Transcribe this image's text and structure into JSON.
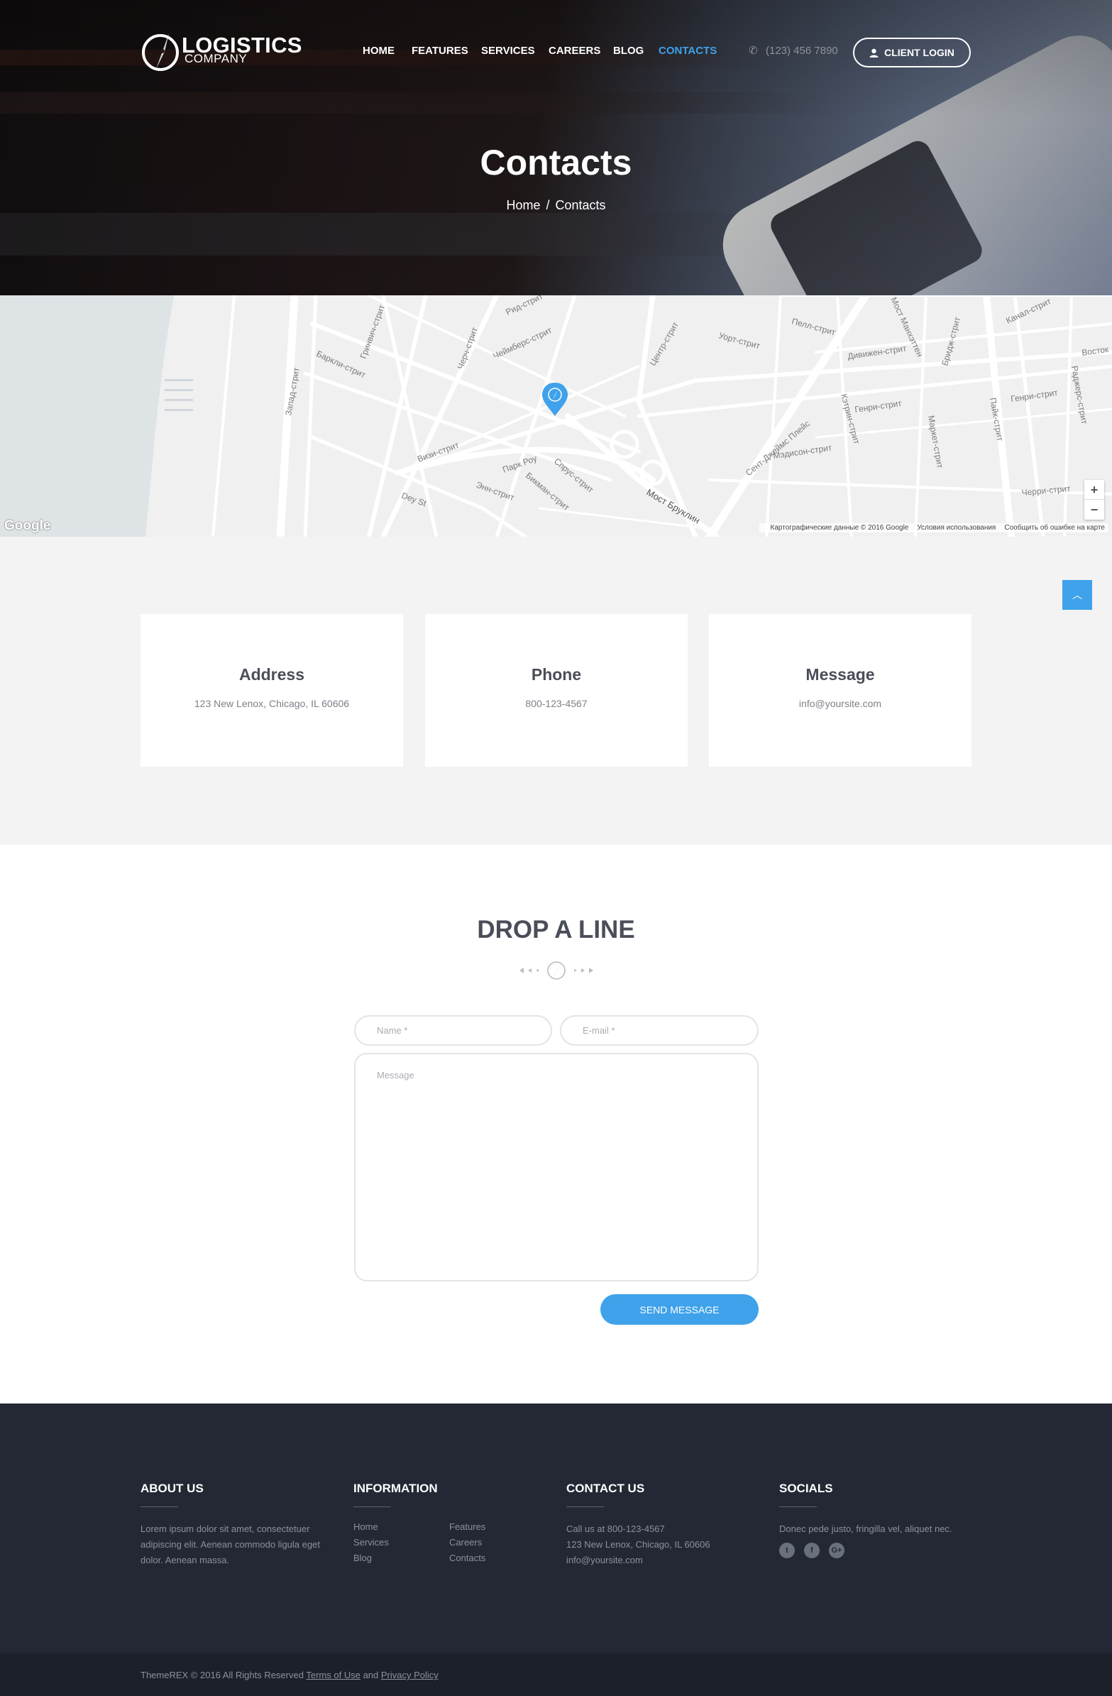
{
  "brand": {
    "name_line1": "LOGISTICS",
    "name_line2": "COMPANY",
    "accent_color": "#3fa2ea"
  },
  "nav": {
    "items": [
      {
        "label": "HOME",
        "active": false
      },
      {
        "label": "FEATURES",
        "active": false
      },
      {
        "label": "SERVICES",
        "active": false
      },
      {
        "label": "CAREERS",
        "active": false
      },
      {
        "label": "BLOG",
        "active": false
      },
      {
        "label": "CONTACTS",
        "active": true
      }
    ],
    "phone": "(123) 456 7890",
    "phone_icon": "phone-icon",
    "client_login": "CLIENT LOGIN",
    "client_icon": "user-icon"
  },
  "hero": {
    "title": "Contacts",
    "breadcrumb": {
      "home": "Home",
      "separator": "/",
      "current": "Contacts"
    }
  },
  "map": {
    "provider": "Google",
    "attribution": "Картографические данные © 2016 Google",
    "terms": "Условия использования",
    "report": "Сообщить об ошибке на карте",
    "zoom_in": "+",
    "zoom_out": "−",
    "street_labels": [
      "Рид-стрит",
      "Чеймберс-стрит",
      "Баркли-стрит",
      "Гринвич-стрит",
      "Черч-стрит",
      "Запад-стрит",
      "Центр-стрит",
      "Пелл-стрит",
      "Уорт-стрит",
      "Дивижен-стрит",
      "Мост Манхэттен",
      "Бридж-стрит",
      "Канал-стрит",
      "Восток",
      "Генри-стрит",
      "Маркет-стрит",
      "Пайк-стрит",
      "Раджерс-стрит",
      "Кэтрин-стрит",
      "Сент-Джеймс Плейс",
      "Мэдисон-стрит",
      "Черри-стрит",
      "Визи-стрит",
      "Парк Роу",
      "Спрус-стрит",
      "Бикман-стрит",
      "Энн-стрит",
      "Dey St",
      "Мост Бруклин"
    ],
    "pin_icon": "map-pin-icon"
  },
  "cards": [
    {
      "title": "Address",
      "text": "123 New Lenox, Chicago, IL 60606"
    },
    {
      "title": "Phone",
      "text": "800-123-4567"
    },
    {
      "title": "Message",
      "text": "info@yoursite.com"
    }
  ],
  "back_to_top_icon": "chevron-up-icon",
  "form": {
    "title": "DROP A LINE",
    "name_placeholder": "Name *",
    "email_placeholder": "E-mail *",
    "message_placeholder": "Message",
    "submit": "SEND MESSAGE"
  },
  "footer": {
    "about": {
      "title": "ABOUT US",
      "text": "Lorem ipsum dolor sit amet, consectetuer adipiscing elit. Aenean commodo ligula eget dolor. Aenean massa."
    },
    "information": {
      "title": "INFORMATION",
      "links": [
        "Home",
        "Features",
        "Services",
        "Careers",
        "Blog",
        "Contacts"
      ]
    },
    "contact": {
      "title": "CONTACT US",
      "lines": [
        "Call us at 800-123-4567",
        "123 New Lenox, Chicago, IL 60606",
        "info@yoursite.com"
      ]
    },
    "socials": {
      "title": "SOCIALS",
      "text": "Donec pede justo, fringilla vel, aliquet nec.",
      "icons": [
        "twitter-icon",
        "facebook-icon",
        "google-plus-icon"
      ]
    }
  },
  "bottom": {
    "copyright": "ThemeREX © 2016 All Rights Reserved",
    "terms": "Terms of Use",
    "and": "and",
    "privacy": "Privacy Policy"
  }
}
